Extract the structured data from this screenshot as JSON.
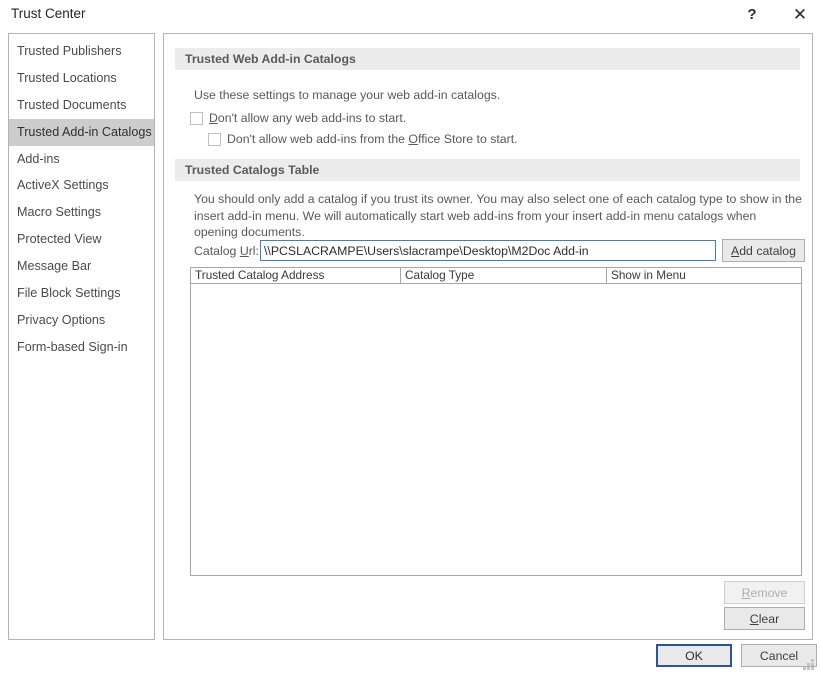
{
  "window": {
    "title": "Trust Center",
    "help_icon": "question-mark-icon",
    "close_icon": "close-icon"
  },
  "sidebar": {
    "items": [
      {
        "label": "Trusted Publishers",
        "selected": false
      },
      {
        "label": "Trusted Locations",
        "selected": false
      },
      {
        "label": "Trusted Documents",
        "selected": false
      },
      {
        "label": "Trusted Add-in Catalogs",
        "selected": true
      },
      {
        "label": "Add-ins",
        "selected": false
      },
      {
        "label": "ActiveX Settings",
        "selected": false
      },
      {
        "label": "Macro Settings",
        "selected": false
      },
      {
        "label": "Protected View",
        "selected": false
      },
      {
        "label": "Message Bar",
        "selected": false
      },
      {
        "label": "File Block Settings",
        "selected": false
      },
      {
        "label": "Privacy Options",
        "selected": false
      },
      {
        "label": "Form-based Sign-in",
        "selected": false
      }
    ]
  },
  "sections": {
    "web_addin_catalogs": {
      "header": "Trusted Web Add-in Catalogs",
      "description": "Use these settings to manage your web add-in catalogs.",
      "checkbox_1_label_pre": "D",
      "checkbox_1_label_post": "on't allow any web add-ins to start.",
      "checkbox_1_checked": false,
      "checkbox_2_label_pre": "Don't allow web add-ins from the ",
      "checkbox_2_label_mid": "O",
      "checkbox_2_label_post": "ffice Store to start.",
      "checkbox_2_checked": false
    },
    "catalogs_table": {
      "header": "Trusted Catalogs Table",
      "description": "You should only add a catalog if you trust its owner. You may also select one of each catalog type to show in the insert add-in menu. We will automatically start web add-ins from your insert add-in menu catalogs when opening documents.",
      "url_label_pre": "Catalog ",
      "url_label_mid": "U",
      "url_label_post": "rl:",
      "url_value": "\\\\PCSLACRAMPE\\Users\\slacrampe\\Desktop\\M2Doc Add-in",
      "url_placeholder": "",
      "add_catalog_pre": "A",
      "add_catalog_post": "dd catalog",
      "columns": [
        "Trusted Catalog Address",
        "Catalog Type",
        "Show in Menu"
      ],
      "rows": [],
      "remove_pre": "R",
      "remove_post": "emove",
      "remove_enabled": false,
      "clear_pre": "C",
      "clear_post": "lear",
      "clear_enabled": true
    }
  },
  "footer": {
    "ok_label": "OK",
    "cancel_label": "Cancel"
  },
  "colors": {
    "accent": "#2a5699",
    "focus_border": "#3f7fbf",
    "selection": "#cdcdcd",
    "section_header_bg": "#ececec"
  }
}
